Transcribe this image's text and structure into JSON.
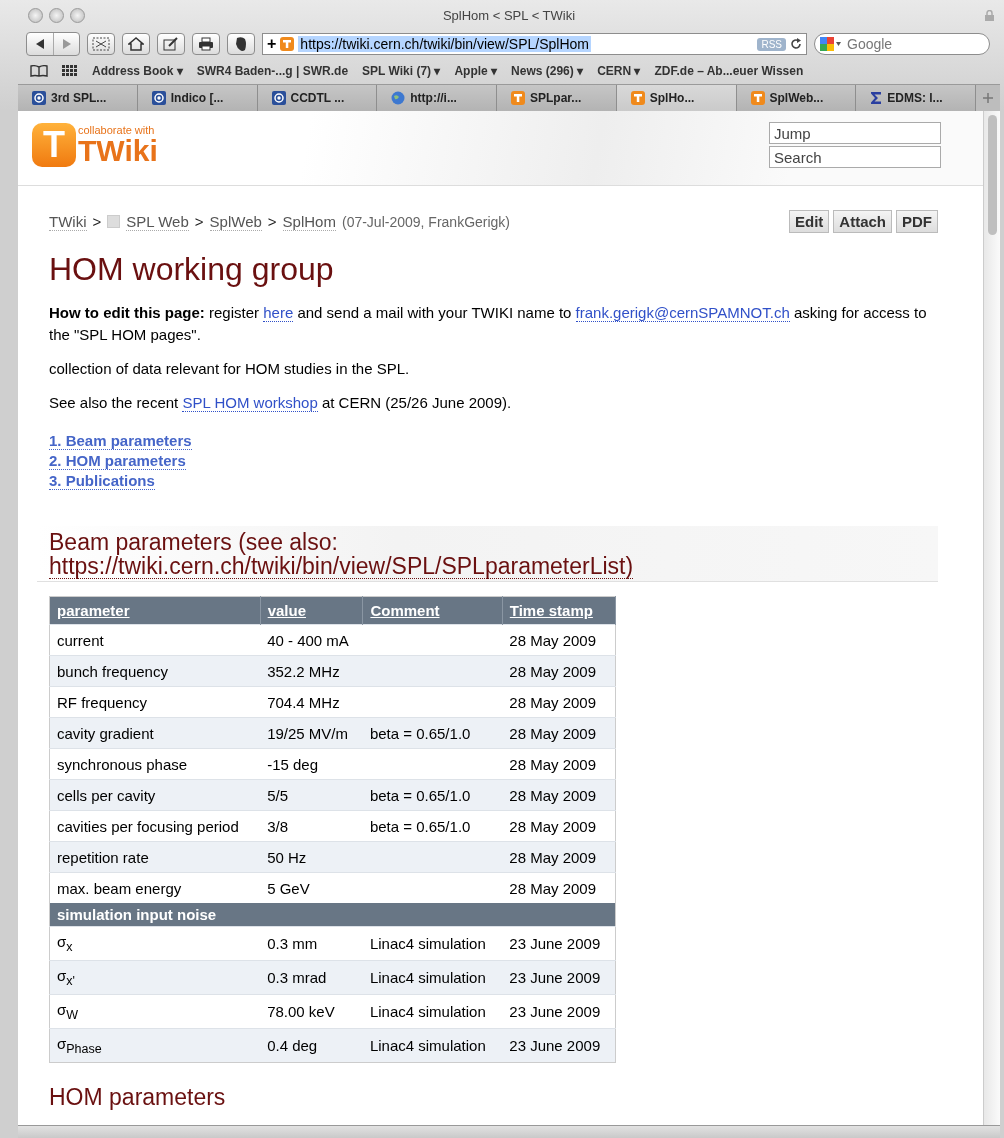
{
  "window": {
    "title": "SplHom < SPL < TWiki"
  },
  "toolbar": {
    "url": "https://twiki.cern.ch/twiki/bin/view/SPL/SplHom",
    "rss": "RSS",
    "search_placeholder": "Google",
    "add": "+"
  },
  "bookmarks": [
    "Address Book ▾",
    "SWR4 Baden-...g | SWR.de",
    "SPL Wiki (7) ▾",
    "Apple ▾",
    "News (296) ▾",
    "CERN ▾",
    "ZDF.de – Ab...euer Wissen"
  ],
  "tabs": [
    {
      "label": "3rd SPL...",
      "kind": "cern",
      "selected": false
    },
    {
      "label": "Indico [...",
      "kind": "cern",
      "selected": false
    },
    {
      "label": "CCDTL ...",
      "kind": "cern",
      "selected": false
    },
    {
      "label": "http://i...",
      "kind": "globe",
      "selected": false
    },
    {
      "label": "SPLpar...",
      "kind": "twiki",
      "selected": false
    },
    {
      "label": "SplHo...",
      "kind": "twiki",
      "selected": true
    },
    {
      "label": "SplWeb...",
      "kind": "twiki",
      "selected": false
    },
    {
      "label": "EDMS: l...",
      "kind": "sigma",
      "selected": false
    }
  ],
  "header": {
    "logo_tagline": "collaborate with",
    "logo_letter": "T",
    "logo_name": "TWiki",
    "jump_placeholder": "Jump",
    "search_placeholder": "Search"
  },
  "breadcrumb": {
    "items": [
      "TWiki",
      "SPL Web",
      "SplWeb",
      "SplHom"
    ],
    "separator": ">",
    "meta": "(07-Jul-2009, FrankGerigk)"
  },
  "actions": [
    "Edit",
    "Attach",
    "PDF"
  ],
  "title": "HOM working group",
  "paragraphs": [
    [
      {
        "kind": "bold",
        "text": "How to edit this page:"
      },
      {
        "kind": "text",
        "text": " register "
      },
      {
        "kind": "link",
        "text": "here"
      },
      {
        "kind": "text",
        "text": " and send a mail with your TWIKI name to "
      },
      {
        "kind": "link",
        "text": "frank.gerigk@cernSPAMNOT.ch"
      },
      {
        "kind": "text",
        "text": " asking for access to the \"SPL HOM pages\"."
      }
    ],
    [
      {
        "kind": "text",
        "text": "collection of data relevant for HOM studies in the SPL."
      }
    ],
    [
      {
        "kind": "text",
        "text": "See also the recent "
      },
      {
        "kind": "link",
        "text": "SPL HOM workshop"
      },
      {
        "kind": "text",
        "text": " at CERN (25/26 June 2009)."
      }
    ]
  ],
  "toc": [
    "1. Beam parameters",
    "2. HOM parameters",
    "3. Publications"
  ],
  "section": {
    "title": "Beam parameters (see also:",
    "link": "https://twiki.cern.ch/twiki/bin/view/SPL/SPLparameterList)"
  },
  "table": {
    "columns": [
      "parameter",
      "value",
      "Comment",
      "Time stamp"
    ],
    "rows": [
      {
        "kind": "row",
        "cells": [
          "current",
          "40 - 400 mA",
          "",
          "28 May 2009"
        ]
      },
      {
        "kind": "row",
        "cells": [
          "bunch frequency",
          "352.2 MHz",
          "",
          "28 May 2009"
        ]
      },
      {
        "kind": "row",
        "cells": [
          "RF frequency",
          "704.4 MHz",
          "",
          "28 May 2009"
        ]
      },
      {
        "kind": "row",
        "cells": [
          "cavity gradient",
          "19/25 MV/m",
          "beta = 0.65/1.0",
          "28 May 2009"
        ]
      },
      {
        "kind": "row",
        "cells": [
          "synchronous phase",
          "-15 deg",
          "",
          "28 May 2009"
        ]
      },
      {
        "kind": "row",
        "cells": [
          "cells per cavity",
          "5/5",
          "beta = 0.65/1.0",
          "28 May 2009"
        ]
      },
      {
        "kind": "row",
        "cells": [
          "cavities per focusing period",
          "3/8",
          "beta = 0.65/1.0",
          "28 May 2009"
        ]
      },
      {
        "kind": "row",
        "cells": [
          "repetition rate",
          "50 Hz",
          "",
          "28 May 2009"
        ]
      },
      {
        "kind": "row",
        "cells": [
          "max. beam energy",
          "5 GeV",
          "",
          "28 May 2009"
        ]
      },
      {
        "kind": "group",
        "cells": [
          "simulation input noise",
          "",
          "",
          ""
        ]
      },
      {
        "kind": "row",
        "cells": [
          "σ$_{x}$",
          "0.3 mm",
          "Linac4 simulation",
          "23 June 2009"
        ]
      },
      {
        "kind": "row",
        "cells": [
          "σ$_{x'}$",
          "0.3 mrad",
          "Linac4 simulation",
          "23 June 2009"
        ]
      },
      {
        "kind": "row",
        "cells": [
          "σ$_{W}$",
          "78.00 keV",
          "Linac4 simulation",
          "23 June 2009"
        ]
      },
      {
        "kind": "row",
        "cells": [
          "σ$_{Phase}$",
          "0.4 deg",
          "Linac4 simulation",
          "23 June 2009"
        ]
      }
    ]
  },
  "next_section": "HOM parameters"
}
